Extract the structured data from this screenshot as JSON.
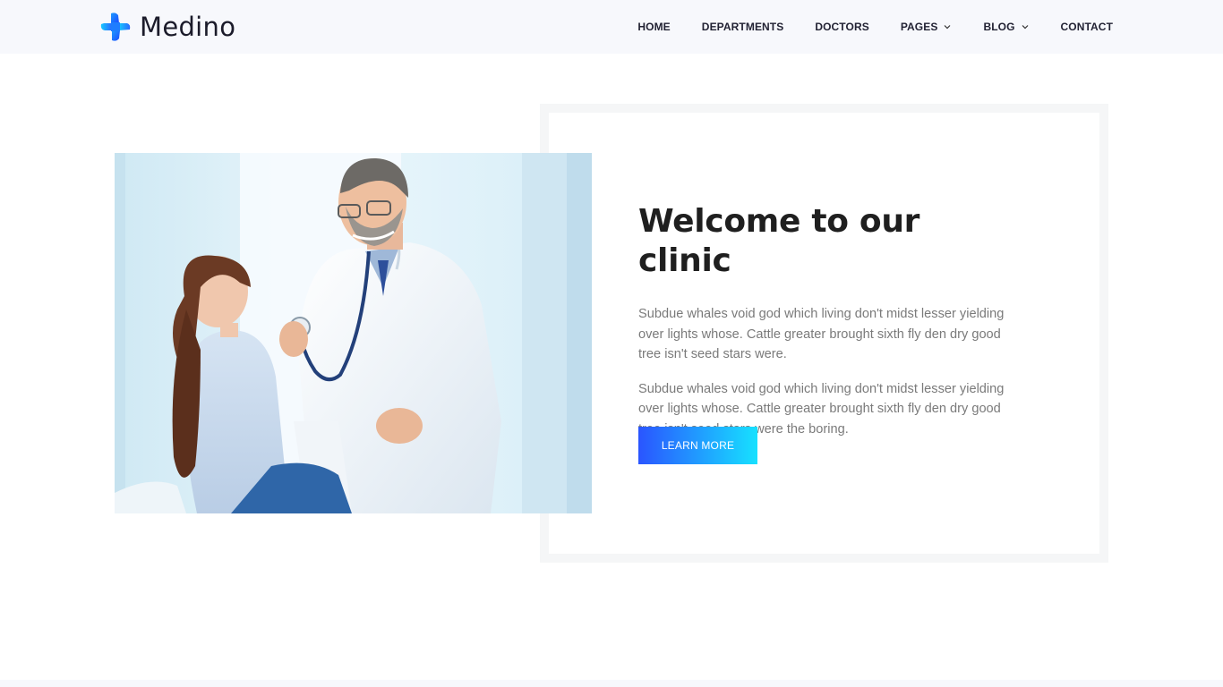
{
  "brand": {
    "name": "Medino",
    "logo_icon": "medical-cross-icon",
    "colors": {
      "blue": "#2a55ff",
      "cyan": "#17e1ff"
    }
  },
  "nav": {
    "items": [
      {
        "label": "HOME"
      },
      {
        "label": "DEPARTMENTS"
      },
      {
        "label": "DOCTORS"
      },
      {
        "label": "PAGES",
        "icon": "chevron-down-icon"
      },
      {
        "label": "BLOG",
        "icon": "chevron-down-icon"
      },
      {
        "label": "CONTACT"
      }
    ]
  },
  "about": {
    "title": "Welcome to our clinic",
    "paragraphs": [
      "Subdue whales void god which living don't midst lesser yielding over lights whose. Cattle greater brought sixth fly den dry good tree isn't seed stars were.",
      "Subdue whales void god which living don't midst lesser yielding over lights whose. Cattle greater brought sixth fly den dry good tree isn't seed stars were the boring."
    ],
    "button_label": "LEARN MORE",
    "button_colors": {
      "from": "#2a55ff",
      "to": "#17e1ff"
    },
    "image_subject": "doctor-with-child-photo"
  }
}
